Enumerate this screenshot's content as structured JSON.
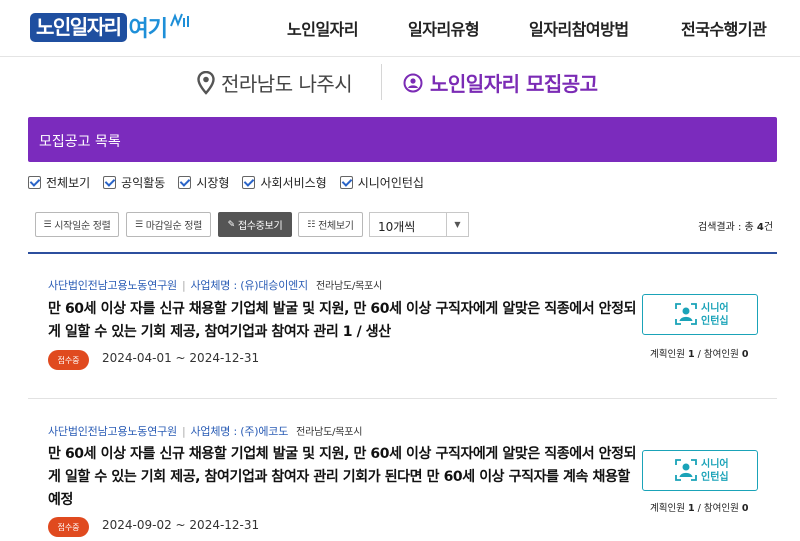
{
  "header": {
    "logo_part1": "노인일자리",
    "logo_part2": "여기",
    "nav": [
      "노인일자리",
      "일자리유형",
      "일자리참여방법",
      "전국수행기관"
    ]
  },
  "location": {
    "region": "전라남도 나주시",
    "section_title": "노인일자리 모집공고"
  },
  "list": {
    "header": "모집공고 목록",
    "filters": [
      "전체보기",
      "공익활동",
      "시장형",
      "사회서비스형",
      "시니어인턴십"
    ],
    "toolbar": {
      "sort_start": "시작일순 정렬",
      "sort_end": "마감일순 정렬",
      "receiving": "접수중보기",
      "view_all": "전체보기",
      "page_size": "10개씩",
      "result_prefix": "검색결과 : 총",
      "result_count": "4",
      "result_suffix": "건"
    }
  },
  "items": [
    {
      "org": "사단법인전남고용노동연구원",
      "company_label": "사업체명 : (유)대승이엔지",
      "region": "전라남도/목포시",
      "title": "만 60세 이상 자를 신규 채용할 기업체 발굴 및 지원, 만 60세 이상 구직자에게 알맞은 직종에서 안정되게 일할 수 있는 기회 제공, 참여기업과 참여자 관리 1 / 생산",
      "status": "접수중",
      "period": "2024-04-01 ~ 2024-12-31",
      "type_line1": "시니어",
      "type_line2": "인턴십",
      "plan_label": "계획인원",
      "plan_count": "1",
      "join_label": "참여인원",
      "join_count": "0"
    },
    {
      "org": "사단법인전남고용노동연구원",
      "company_label": "사업체명 : (주)에코도",
      "region": "전라남도/목포시",
      "title": "만 60세 이상 자를 신규 채용할 기업체 발굴 및 지원, 만 60세 이상 구직자에게 알맞은 직종에서 안정되게 일할 수 있는 기회 제공, 참여기업과 참여자 관리 기회가 된다면 만 60세 이상 구직자를 계속 채용할 예정",
      "status": "접수중",
      "period": "2024-09-02 ~ 2024-12-31",
      "type_line1": "시니어",
      "type_line2": "인턴십",
      "plan_label": "계획인원",
      "plan_count": "1",
      "join_label": "참여인원",
      "join_count": "0"
    }
  ],
  "colors": {
    "purple": "#7b2bbd",
    "navy": "#2c4f9e",
    "teal": "#1aa3b8",
    "badge": "#e04a1f"
  }
}
